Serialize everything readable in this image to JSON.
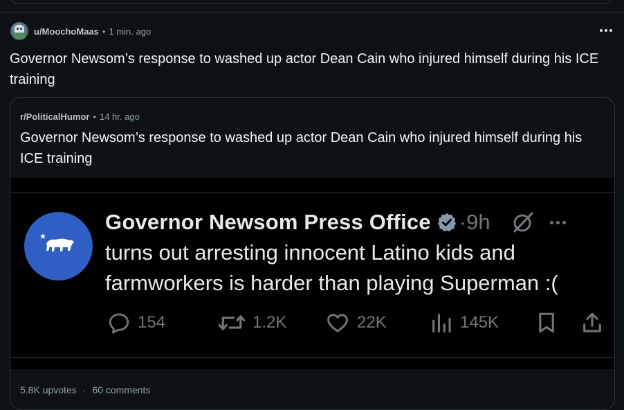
{
  "post": {
    "username": "u/MoochoMaas",
    "separator": "•",
    "time_ago": "1 min. ago",
    "title": "Governor Newsom’s response to washed up actor Dean Cain who injured himself during his ICE training"
  },
  "crosspost": {
    "subreddit": "r/PoliticalHumor",
    "separator": "•",
    "time_ago": "14 hr. ago",
    "title": "Governor Newsom’s response to washed up actor Dean Cain who injured himself during his ICE training",
    "upvotes": "5.8K upvotes",
    "footer_separator": "·",
    "comments": "60 comments"
  },
  "tweet": {
    "author": "Governor Newsom Press Office",
    "time": "·9h",
    "text": "turns out arresting innocent Latino kids and farmworkers is harder than playing Superman :(",
    "replies": "154",
    "reposts": "1.2K",
    "likes": "22K",
    "views": "145K",
    "colors": {
      "avatar_bg": "#2f5ec5",
      "text": "#e7e9ea",
      "muted": "#71767b"
    }
  },
  "icons": {
    "post_avatar": "user-avatar",
    "more": "more-horizontal-icon",
    "verified": "verified-badge-icon",
    "grok": "grok-icon",
    "reply": "reply-icon",
    "repost": "repost-icon",
    "like": "heart-icon",
    "views": "views-icon",
    "bookmark": "bookmark-icon",
    "share": "share-icon"
  }
}
